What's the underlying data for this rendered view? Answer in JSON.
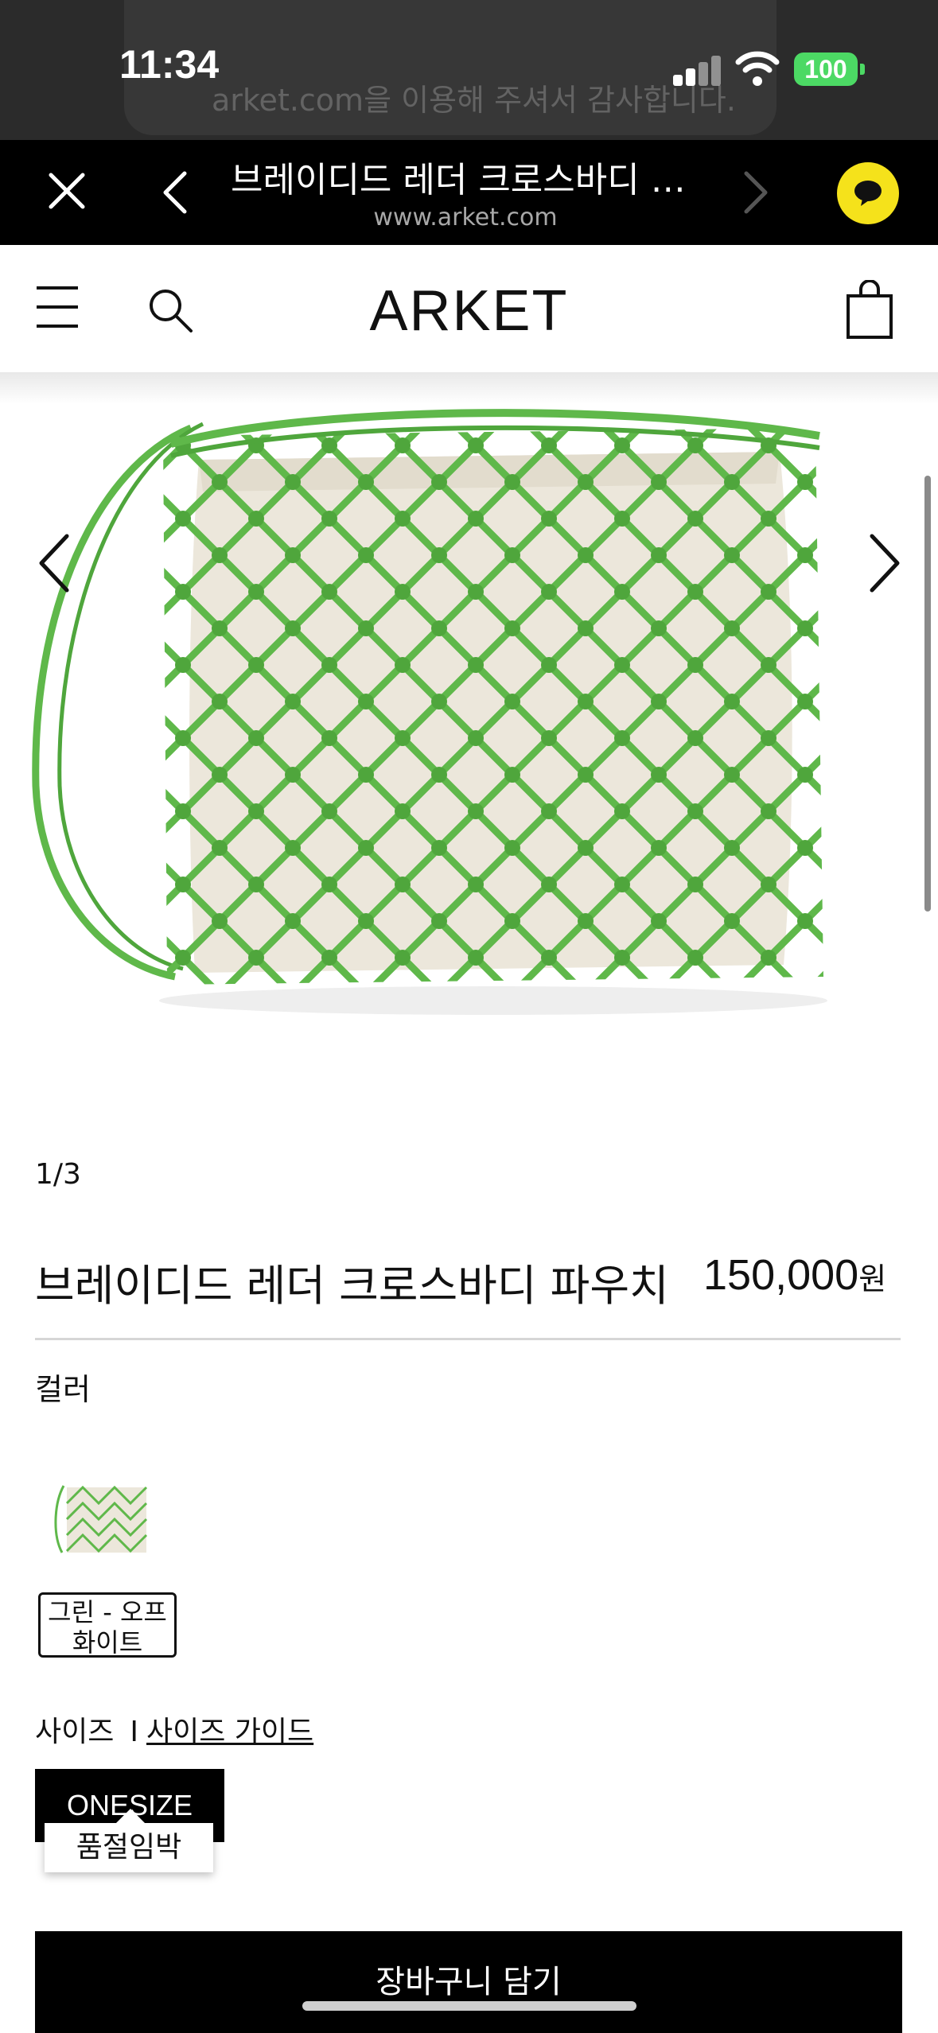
{
  "status_bar": {
    "time": "11:34",
    "battery": "100",
    "background_notification": "arket.com을 이용해 주셔서 감사합니다."
  },
  "webview": {
    "title": "브레이디드 레더 크로스바디 파...",
    "url": "www.arket.com",
    "icons": [
      "close-icon",
      "back-icon",
      "forward-icon",
      "chat-icon"
    ]
  },
  "site_header": {
    "logo": "ARKET",
    "icons": [
      "menu-icon",
      "search-icon",
      "shopping-bag-icon"
    ]
  },
  "gallery": {
    "counter": "1/3",
    "icons": [
      "chevron-left-icon",
      "chevron-right-icon"
    ]
  },
  "product": {
    "title": "브레이디드 레더 크로스바디 파우치",
    "price": "150,000",
    "currency": "원"
  },
  "color_section": {
    "label": "컬러",
    "selected_color_line1": "그린 - 오프",
    "selected_color_line2": "화이트"
  },
  "size_section": {
    "label": "사이즈",
    "separator": "I",
    "guide_link": "사이즈 가이드",
    "selected_size": "ONESIZE",
    "stock_tooltip": "품절임박"
  },
  "cta": {
    "add_to_cart": "장바구니 담기"
  },
  "colors": {
    "bag_green": "#5fb84a",
    "bag_lining": "#ece7db",
    "chat_yellow": "#f5e21b"
  }
}
